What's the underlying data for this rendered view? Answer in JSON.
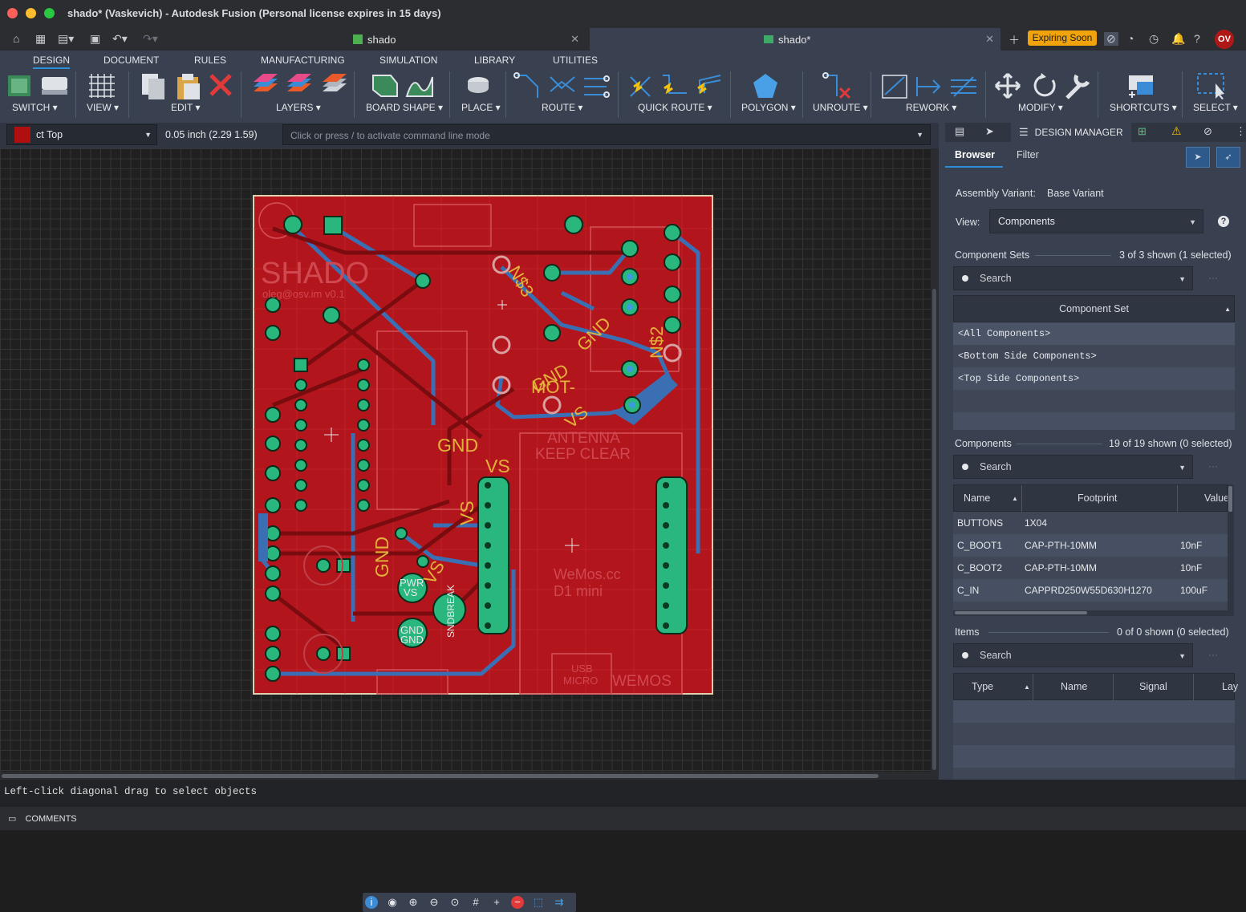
{
  "window": {
    "title": "shado* (Vaskevich) - Autodesk Fusion (Personal license expires in 15 days)"
  },
  "doc_tabs": [
    {
      "label": "shado"
    },
    {
      "label": "shado*"
    }
  ],
  "header_right": {
    "expiring": "Expiring Soon",
    "avatar": "OV"
  },
  "ribbon_tabs": [
    "DESIGN",
    "DOCUMENT",
    "RULES",
    "MANUFACTURING",
    "SIMULATION",
    "LIBRARY",
    "UTILITIES"
  ],
  "groups": [
    "SWITCH ▾",
    "VIEW ▾",
    "EDIT ▾",
    "LAYERS ▾",
    "BOARD SHAPE ▾",
    "PLACE ▾",
    "ROUTE ▾",
    "QUICK ROUTE ▾",
    "POLYGON ▾",
    "UNROUTE ▾",
    "REWORK ▾",
    "MODIFY ▾",
    "SHORTCUTS ▾",
    "SELECT ▾"
  ],
  "cmdbar": {
    "layer": "ct Top",
    "grid": "0.05 inch (2.29 1.59)",
    "placeholder": "Click or press / to activate command line mode"
  },
  "panel": {
    "tab_label": "DESIGN MANAGER",
    "browser": "Browser",
    "filter": "Filter",
    "assembly_label": "Assembly Variant:",
    "assembly_value": "Base Variant",
    "view_label": "View:",
    "view_value": "Components",
    "component_sets_label": "Component Sets",
    "component_sets_count": "3 of 3 shown (1 selected)",
    "search": "Search",
    "component_set_header": "Component Set",
    "component_sets": [
      "<All Components>",
      "<Bottom Side Components>",
      "<Top Side Components>"
    ],
    "components_label": "Components",
    "components_count": "19 of 19 shown (0 selected)",
    "comp_headers": [
      "Name",
      "Footprint",
      "Value"
    ],
    "components": [
      {
        "name": "BUTTONS",
        "footprint": "1X04",
        "value": ""
      },
      {
        "name": "C_BOOT1",
        "footprint": "CAP-PTH-10MM",
        "value": "10nF"
      },
      {
        "name": "C_BOOT2",
        "footprint": "CAP-PTH-10MM",
        "value": "10nF"
      },
      {
        "name": "C_IN",
        "footprint": "CAPPRD250W55D630H1270",
        "value": "100uF"
      }
    ],
    "items_label": "Items",
    "items_count": "0 of 0 shown (0 selected)",
    "item_headers": [
      "Type",
      "Name",
      "Signal",
      "Lay"
    ]
  },
  "board_text": {
    "shado": "SHADO",
    "email": "oleg@osv.im v0.1",
    "gnd1": "GND",
    "vs1": "VS",
    "vs2": "VS",
    "gnd2": "GND",
    "ns3": "N$3",
    "gnd3": "GND",
    "ns2": "N$2",
    "gnd4": "GND",
    "mot": "MOT-",
    "vs3": "VS",
    "antenna": "ANTENNA",
    "keepclear": "KEEP CLEAR",
    "wemos": "WeMos.cc",
    "d1mini": "D1 mini",
    "pwr": "PWR",
    "pvs": "VS",
    "gnd5": "GND",
    "gnd6": "GND",
    "vs4": "VS",
    "sndbreak": "SNDBREAK",
    "usb": "USB",
    "micro": "MICRO",
    "wemos2": "WEMOS"
  },
  "status": "Left-click diagonal drag to select objects",
  "comments": "COMMENTS",
  "colors": {
    "board": "#b3151c",
    "copper_bottom": "#3a6fb4",
    "pad": "#2ab77e",
    "accent": "#2d8fd6",
    "expiring": "#f0a30a"
  }
}
